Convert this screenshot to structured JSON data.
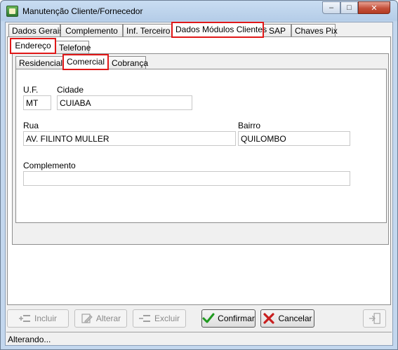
{
  "window": {
    "title": "Manutenção Cliente/Fornecedor",
    "controls": {
      "minimize": "–",
      "maximize": "□",
      "close": "✕"
    }
  },
  "main_tabs": [
    {
      "label": "Dados Gerais"
    },
    {
      "label": "Complemento"
    },
    {
      "label": "Inf. Terceiro"
    },
    {
      "label": "Dados Módulos Clientes",
      "active": true
    },
    {
      "label": "SAP"
    },
    {
      "label": "Chaves Pix"
    }
  ],
  "sub_tabs": [
    {
      "label": "Endereço",
      "active": true
    },
    {
      "label": "Telefone"
    }
  ],
  "address_tabs": [
    {
      "label": "Residencial"
    },
    {
      "label": "Comercial",
      "active": true
    },
    {
      "label": "Cobrança"
    }
  ],
  "form": {
    "uf": {
      "label": "U.F.",
      "value": "MT"
    },
    "cidade": {
      "label": "Cidade",
      "value": "CUIABA"
    },
    "rua": {
      "label": "Rua",
      "value": "AV. FILINTO MULLER"
    },
    "bairro": {
      "label": "Bairro",
      "value": "QUILOMBO"
    },
    "complemento": {
      "label": "Complemento",
      "value": ""
    }
  },
  "buttons": {
    "incluir": "Incluir",
    "alterar": "Alterar",
    "excluir": "Excluir",
    "confirmar": "Confirmar",
    "cancelar": "Cancelar"
  },
  "status": {
    "text": "Alterando..."
  },
  "colors": {
    "highlight": "#e01818",
    "confirm_green": "#1f9a1f",
    "cancel_red": "#c81e1e"
  }
}
